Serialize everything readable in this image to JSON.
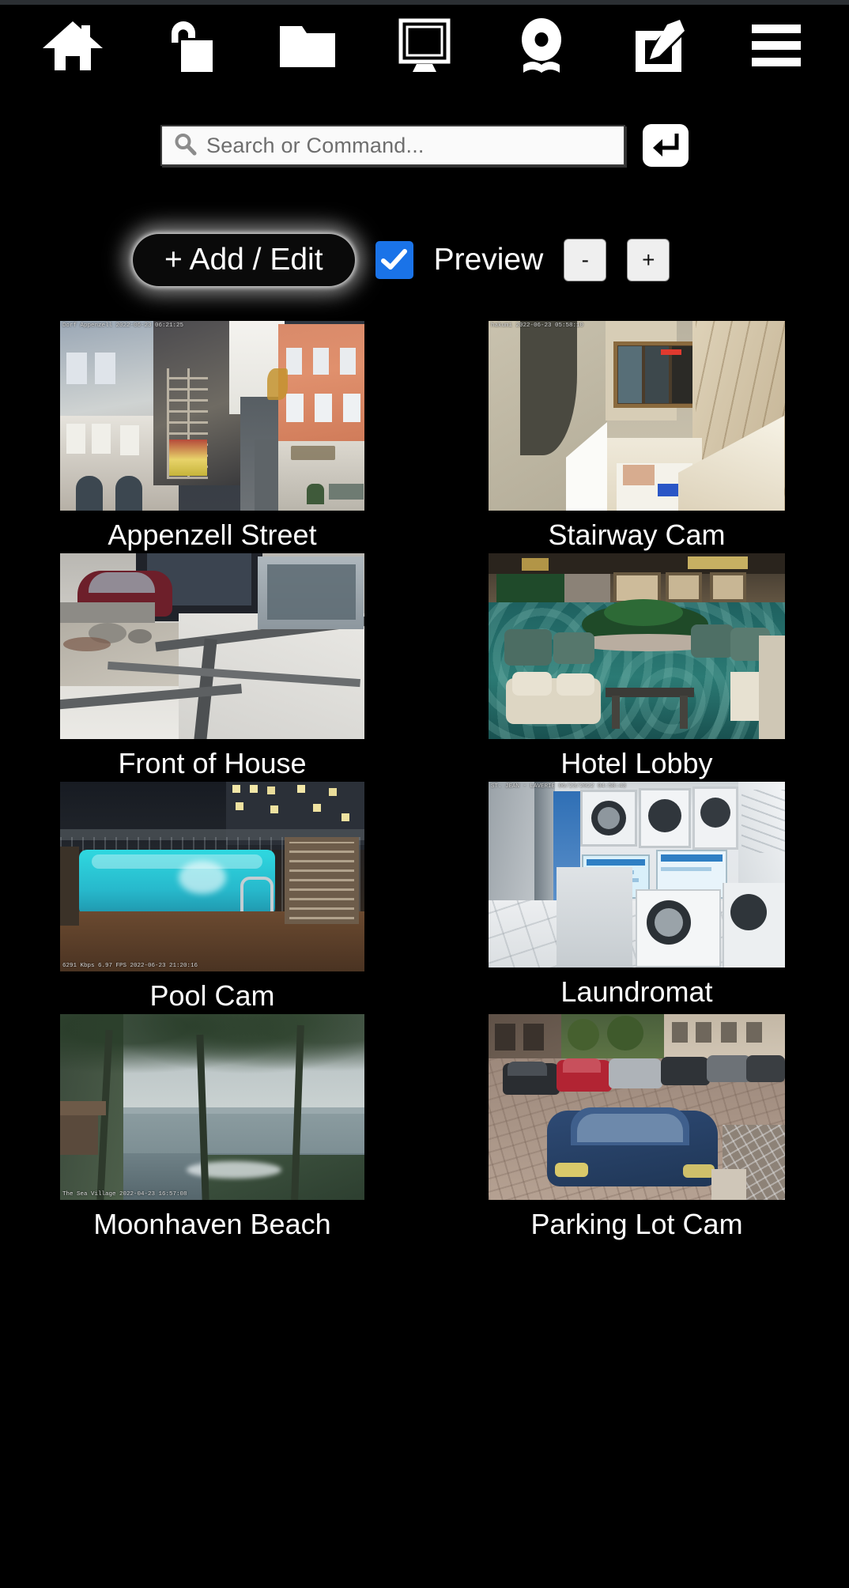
{
  "app": {
    "background": "#000000",
    "accent": "#1a73e8"
  },
  "toolbar": {
    "items": [
      {
        "name": "home-icon",
        "label": "Home"
      },
      {
        "name": "unlock-icon",
        "label": "Unlock"
      },
      {
        "name": "folder-icon",
        "label": "Folder"
      },
      {
        "name": "monitor-icon",
        "label": "Monitor"
      },
      {
        "name": "webcam-icon",
        "label": "Webcam"
      },
      {
        "name": "edit-icon",
        "label": "Edit"
      },
      {
        "name": "hamburger-icon",
        "label": "Menu"
      }
    ]
  },
  "search": {
    "placeholder": "Search or Command...",
    "value": "",
    "icon": "search-icon",
    "submit_icon": "enter-key-icon"
  },
  "controls": {
    "add_edit_label": "+ Add / Edit",
    "preview_label": "Preview",
    "preview_checked": true,
    "zoom_out_label": "-",
    "zoom_in_label": "+"
  },
  "cameras": [
    {
      "label": "Appenzell Street",
      "stamp": "Dorf Appenzell 2022-06-23 06:21:25",
      "stamp_pos": "top"
    },
    {
      "label": "Stairway Cam",
      "stamp": "hakumi   2022-06-23 05:58:10",
      "stamp_pos": "top"
    },
    {
      "label": "Front of House",
      "stamp": "",
      "stamp_pos": "top"
    },
    {
      "label": "Hotel Lobby",
      "stamp": "",
      "stamp_pos": "top"
    },
    {
      "label": "Pool Cam",
      "stamp": "6291 Kbps  6.97 FPS  2022-06-23 21:20:16",
      "stamp_pos": "bottom"
    },
    {
      "label": "Laundromat",
      "stamp": "ST. JEAN - LAVERIE 06/23/2022 04:58:43",
      "stamp_pos": "top"
    },
    {
      "label": "Moonhaven Beach",
      "stamp": "The Sea Village 2022-04-23 16:57:08",
      "stamp_pos": "bottom"
    },
    {
      "label": "Parking Lot Cam",
      "stamp": "",
      "stamp_pos": "top"
    }
  ]
}
